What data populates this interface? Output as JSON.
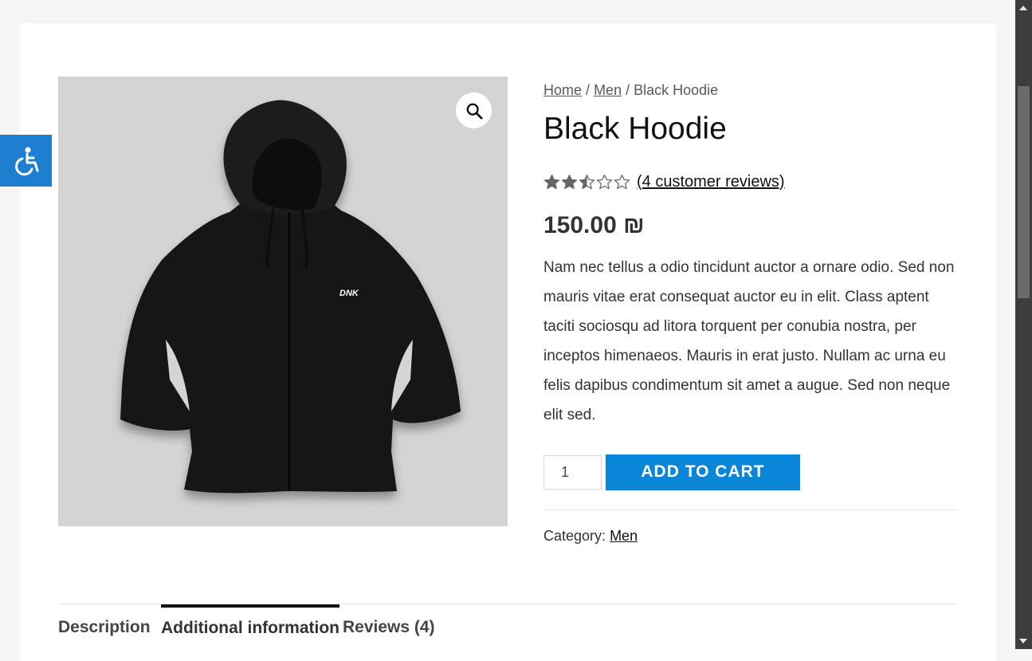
{
  "breadcrumb": {
    "home": "Home",
    "sep1": "/",
    "men": "Men",
    "sep2": "/",
    "current": "Black Hoodie"
  },
  "product": {
    "title": "Black Hoodie",
    "rating": 2.5,
    "rating_max": 5,
    "reviews_link": "(4 customer reviews)",
    "price": "150.00 ₪",
    "description": "Nam nec tellus a odio tincidunt auctor a ornare odio. Sed non mauris vitae erat consequat auctor eu in elit. Class aptent taciti sociosqu ad litora torquent per conubia nostra, per inceptos himenaeos. Mauris in erat justo. Nullam ac urna eu felis dapibus condimentum sit amet a augue. Sed non neque elit sed.",
    "quantity": "1",
    "add_to_cart": "ADD TO CART",
    "category_label": "Category:",
    "category_value": "Men",
    "image_logo_text": "DNK"
  },
  "tabs": {
    "description": "Description",
    "additional": "Additional information",
    "reviews": "Reviews (4)"
  },
  "icons": {
    "zoom": "magnifier-icon",
    "accessibility": "wheelchair-icon",
    "star": "star-icon"
  },
  "colors": {
    "accent": "#0a86d8",
    "a11y": "#1e7fd1",
    "star": "#666666"
  }
}
